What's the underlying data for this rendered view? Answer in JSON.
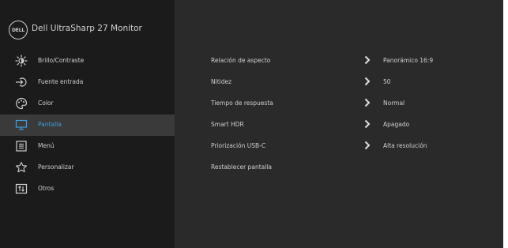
{
  "header": {
    "logo_text": "DELL",
    "model": "Dell UltraSharp 27 Monitor"
  },
  "colors": {
    "sidebar_bg": "#1b1b1b",
    "content_bg": "#2a2a2a",
    "active_bg": "#3a3a3a",
    "accent": "#3aa0d8",
    "text": "#d0d0d0"
  },
  "menu": {
    "items": [
      {
        "label": "Brillo/Contraste",
        "icon": "brightness-icon",
        "active": false
      },
      {
        "label": "Fuente entrada",
        "icon": "input-source-icon",
        "active": false
      },
      {
        "label": "Color",
        "icon": "color-palette-icon",
        "active": false
      },
      {
        "label": "Pantalla",
        "icon": "display-monitor-icon",
        "active": true
      },
      {
        "label": "Menú",
        "icon": "menu-list-icon",
        "active": false
      },
      {
        "label": "Personalizar",
        "icon": "star-icon",
        "active": false
      },
      {
        "label": "Otros",
        "icon": "others-icon",
        "active": false
      }
    ]
  },
  "settings": {
    "rows": [
      {
        "label": "Relación de aspecto",
        "value": "Panorámico 16:9",
        "has_submenu": true
      },
      {
        "label": "Nitidez",
        "value": "50",
        "has_submenu": true
      },
      {
        "label": "Tiempo de respuesta",
        "value": "Normal",
        "has_submenu": true
      },
      {
        "label": "Smart HDR",
        "value": "Apagado",
        "has_submenu": true
      },
      {
        "label": "Priorización USB-C",
        "value": "Alta resolución",
        "has_submenu": true
      },
      {
        "label": "Restablecer pantalla",
        "value": "",
        "has_submenu": false
      }
    ]
  }
}
